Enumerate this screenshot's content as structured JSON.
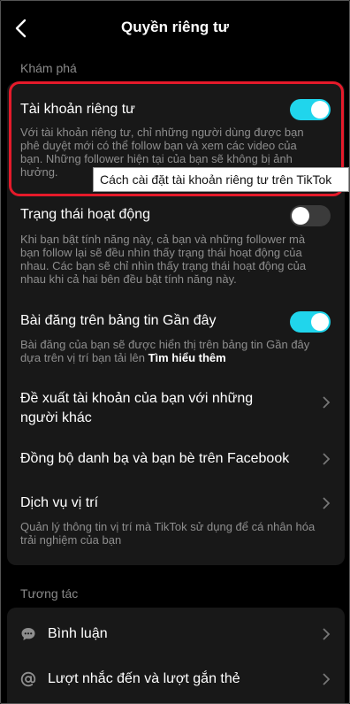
{
  "header": {
    "title": "Quyền riêng tư"
  },
  "sections": {
    "discover_label": "Khám phá",
    "interact_label": "Tương tác"
  },
  "discover": {
    "private_account": {
      "title": "Tài khoản riêng tư",
      "desc": "Với tài khoản riêng tư, chỉ những người dùng được bạn phê duyệt mới có thể follow bạn và xem các video của bạn. Những follower hiện tại của bạn sẽ không bị ảnh hưởng.",
      "toggle_on": true
    },
    "activity_status": {
      "title": "Trạng thái hoạt động",
      "desc": "Khi bạn bật tính năng này, cả bạn và những follower mà bạn follow lại sẽ đều nhìn thấy trạng thái hoạt động của nhau. Các bạn sẽ chỉ nhìn thấy trạng thái hoạt động của nhau khi cả hai bên đều bật tính năng này.",
      "toggle_on": false
    },
    "nearby_posts": {
      "title": "Bài đăng trên bảng tin Gần đây",
      "desc": "Bài đăng của bạn sẽ được hiển thị trên bảng tin Gần đây dựa trên vị trí bạn tải lên",
      "link": "Tìm hiểu thêm",
      "toggle_on": true
    },
    "suggest_account": {
      "title_line1": "Đề xuất tài khoản của bạn với những",
      "title_line2": "người khác"
    },
    "sync_contacts": {
      "title": "Đồng bộ danh bạ và bạn bè trên Facebook"
    },
    "location_services": {
      "title": "Dịch vụ vị trí",
      "desc": "Quản lý thông tin vị trí mà TikTok sử dụng để cá nhân hóa trải nghiệm của bạn"
    }
  },
  "interact": {
    "comments": {
      "title": "Bình luận",
      "icon": "comment-icon"
    },
    "mentions": {
      "title": "Lượt nhắc đến và lượt gắn thẻ",
      "icon": "at-icon"
    }
  },
  "tooltip": "Cách cài đặt tài khoản riêng tư trên TikTok",
  "colors": {
    "accent": "#20d5ec",
    "highlight": "#e51a2a",
    "card": "#181818",
    "muted": "#8e8e8e"
  }
}
